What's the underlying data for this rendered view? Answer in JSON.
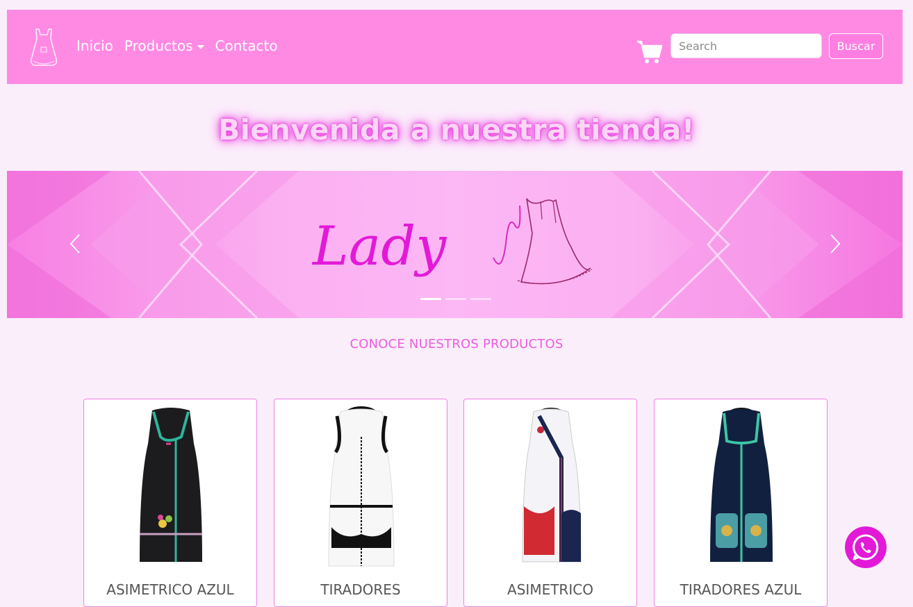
{
  "navbar": {
    "links": [
      {
        "label": "Inicio"
      },
      {
        "label": "Productos",
        "has_dropdown": true
      },
      {
        "label": "Contacto"
      }
    ],
    "search": {
      "placeholder": "Search",
      "value": ""
    },
    "search_button": "Buscar",
    "icons": {
      "logo": "apron-logo-icon",
      "cart": "shopping-cart-icon"
    }
  },
  "hero": {
    "title": "Bienvenida a nuestra tienda!"
  },
  "carousel": {
    "banner_text": "Lady",
    "slide_count": 3,
    "active_slide": 0,
    "icons": {
      "prev": "chevron-left-icon",
      "next": "chevron-right-icon"
    }
  },
  "products_section": {
    "title": "CONOCE NUESTROS PRODUCTOS"
  },
  "products": [
    {
      "name": "ASIMETRICO AZUL",
      "colors": {
        "body": "#1c1c1f",
        "trim": "#2fb59c"
      }
    },
    {
      "name": "TIRADORES",
      "colors": {
        "body": "#f7f7f7",
        "trim": "#111111"
      }
    },
    {
      "name": "ASIMETRICO",
      "colors": {
        "body": "#f4f4f8",
        "trim": "#1a2550"
      }
    },
    {
      "name": "TIRADORES AZUL",
      "colors": {
        "body": "#12203f",
        "trim": "#3bc6a5"
      }
    }
  ],
  "whatsapp": {
    "icon": "whatsapp-icon"
  },
  "colors": {
    "navbar": "#ff8ae4",
    "accent": "#e21ad7",
    "background": "#fbeefb"
  }
}
